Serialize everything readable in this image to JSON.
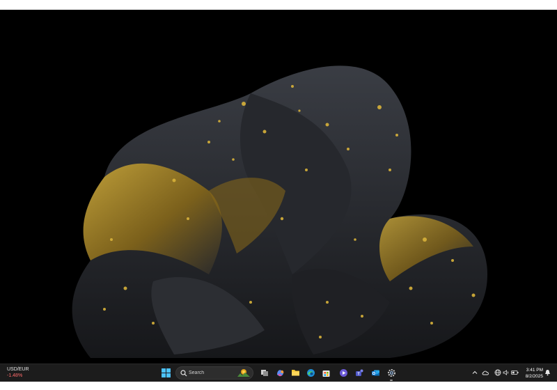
{
  "taskbar": {
    "widget": {
      "symbol": "USD/EUR",
      "change": "-1.48%",
      "change_color": "#ff6b6b"
    },
    "search": {
      "placeholder": "Search"
    },
    "pinned_apps": [
      "start-windows-icon",
      "search-highlight-art-icon",
      "task-view-icon",
      "copilot-icon",
      "file-explorer-icon",
      "edge-browser-icon",
      "microsoft-store-icon",
      "media-player-icon",
      "teams-icon",
      "outlook-icon",
      "settings-icon"
    ],
    "tray_icons": [
      "chevron-up-icon",
      "onedrive-cloud-icon",
      "network-globe-icon",
      "volume-icon",
      "battery-icon",
      "notification-bell-icon"
    ],
    "clock": {
      "time": "3:41 PM",
      "date": "8/2/2025"
    }
  },
  "colors": {
    "desktop_background": "#000000",
    "taskbar_background": "#1c1c1c",
    "accent": "#4cc2ff",
    "wallpaper_gold": "#c9a227"
  }
}
